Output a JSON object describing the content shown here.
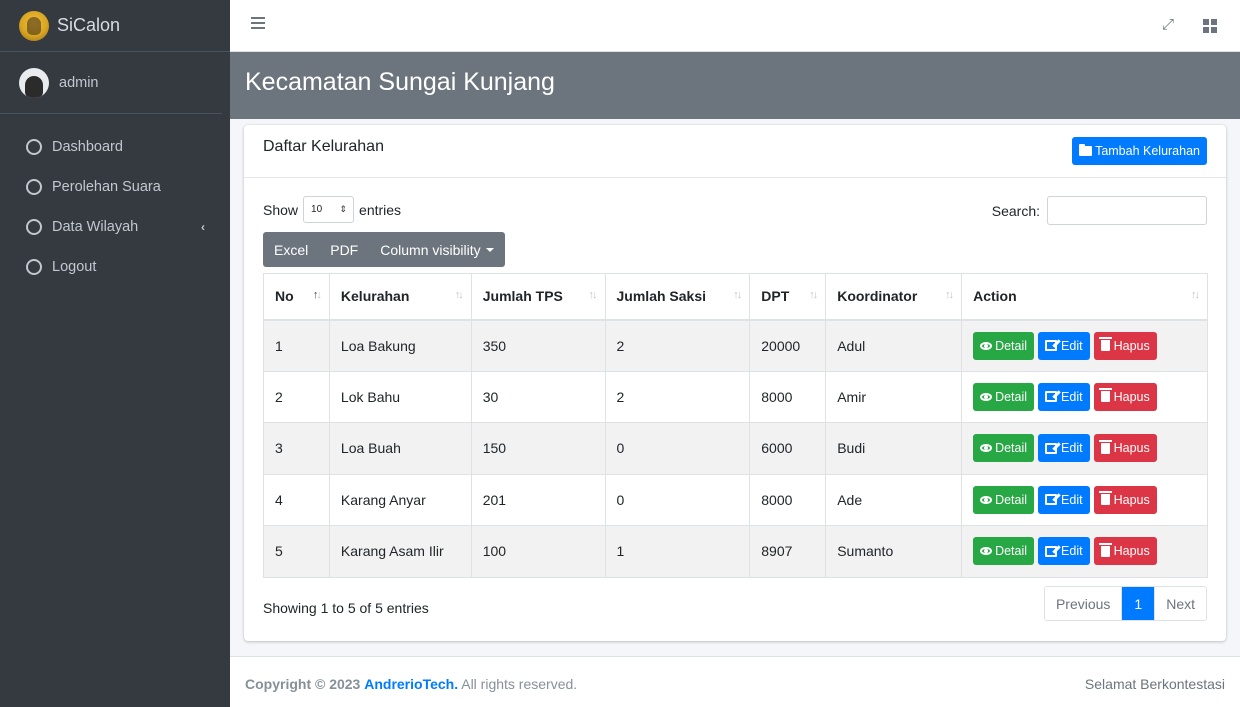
{
  "brand": {
    "name": "SiCalon"
  },
  "user": {
    "name": "admin"
  },
  "nav": [
    {
      "label": "Dashboard"
    },
    {
      "label": "Perolehan Suara"
    },
    {
      "label": "Data Wilayah"
    },
    {
      "label": "Logout"
    }
  ],
  "header": {
    "title": "Kecamatan Sungai Kunjang"
  },
  "card": {
    "title": "Daftar Kelurahan",
    "add_button": "Tambah Kelurahan"
  },
  "table_controls": {
    "show_label": "Show",
    "entries_label": "entries",
    "page_length": "10",
    "search_label": "Search:"
  },
  "export_buttons": [
    "Excel",
    "PDF",
    "Column visibility"
  ],
  "table": {
    "columns": [
      "No",
      "Kelurahan",
      "Jumlah TPS",
      "Jumlah Saksi",
      "DPT",
      "Koordinator",
      "Action"
    ],
    "rows": [
      [
        "1",
        "Loa Bakung",
        "350",
        "2",
        "20000",
        "Adul"
      ],
      [
        "2",
        "Lok Bahu",
        "30",
        "2",
        "8000",
        "Amir"
      ],
      [
        "3",
        "Loa Buah",
        "150",
        "0",
        "6000",
        "Budi"
      ],
      [
        "4",
        "Karang Anyar",
        "201",
        "0",
        "8000",
        "Ade"
      ],
      [
        "5",
        "Karang Asam Ilir",
        "100",
        "1",
        "8907",
        "Sumanto"
      ]
    ],
    "actions": {
      "detail": "Detail",
      "edit": "Edit",
      "delete": "Hapus"
    }
  },
  "table_info": "Showing 1 to 5 of 5 entries",
  "pagination": {
    "previous": "Previous",
    "current": "1",
    "next": "Next"
  },
  "footer": {
    "copyright_prefix": "Copyright © 2023",
    "brand": "AndrerioTech.",
    "rights": "All rights reserved.",
    "right_text": "Selamat Berkontestasi"
  },
  "colors": {
    "sidebar": "#343a40",
    "header_band": "#6c757d",
    "primary": "#007bff",
    "success": "#28a745",
    "danger": "#dc3545"
  }
}
